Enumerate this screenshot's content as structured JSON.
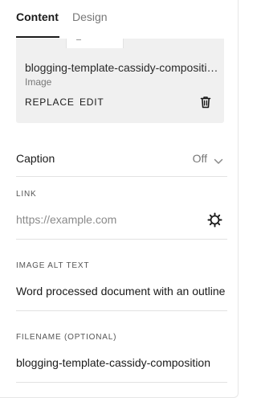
{
  "tabs": [
    {
      "label": "Content"
    },
    {
      "label": "Design"
    }
  ],
  "image_card": {
    "filename": "blogging-template-cassidy-composition.png",
    "type_label": "Image",
    "replace_label": "REPLACE",
    "edit_label": "EDIT",
    "delete_icon": "trash-icon"
  },
  "caption": {
    "label": "Caption",
    "value": "Off",
    "icon": "chevron-down-icon"
  },
  "link": {
    "label": "LINK",
    "value": "",
    "placeholder": "https://example.com",
    "icon": "gear-icon"
  },
  "alt_text": {
    "label": "IMAGE ALT TEXT",
    "value": "Word processed document with an outline"
  },
  "filename_field": {
    "label": "FILENAME (OPTIONAL)",
    "value": "blogging-template-cassidy-composition"
  }
}
